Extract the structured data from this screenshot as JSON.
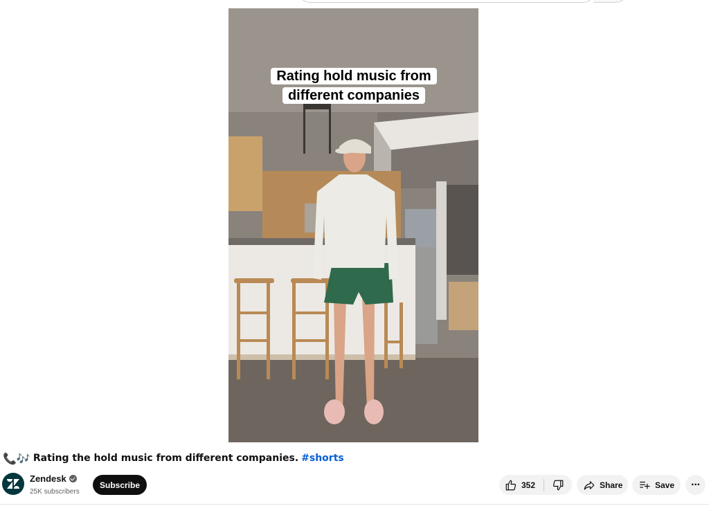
{
  "video": {
    "caption_line1": "Rating hold music from",
    "caption_line2": "different companies"
  },
  "title": {
    "emoji": "📞🎶",
    "text": "Rating the hold music from different companies.",
    "hashtag": "#shorts"
  },
  "channel": {
    "name": "Zendesk",
    "subscribers": "25K subscribers",
    "subscribe_label": "Subscribe"
  },
  "actions": {
    "like_count": "352",
    "share_label": "Share",
    "save_label": "Save",
    "more_label": "···"
  },
  "icons": {
    "like": "thumbs-up-icon",
    "dislike": "thumbs-down-icon",
    "share": "share-arrow-icon",
    "save": "playlist-add-icon",
    "verified": "verified-check-icon"
  },
  "colors": {
    "subscribe_bg": "#0f0f0f",
    "hashtag": "#065fd4",
    "pill_bg": "#f2f2f2",
    "avatar_bg": "#03363d"
  }
}
